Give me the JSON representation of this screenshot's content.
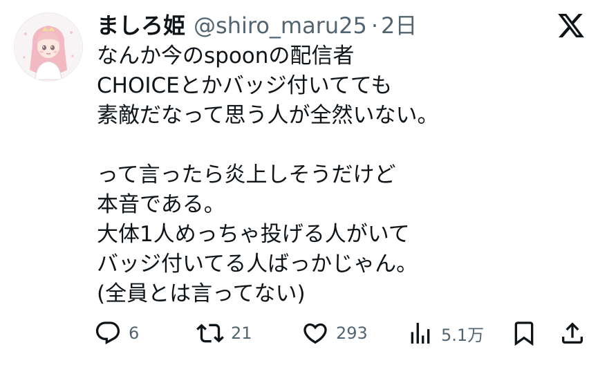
{
  "user": {
    "display_name": "ましろ姫",
    "handle": "@shiro_maru25",
    "separator": "·",
    "time": "2日"
  },
  "tweet": {
    "text": "なんか今のspoonの配信者\nCHOICEとかバッジ付いてても\n素敵だなって思う人が全然いない。\n\nって言ったら炎上しそうだけど\n本音である。\n大体1人めっちゃ投げる人がいて\nバッジ付いてる人ばっかじゃん。\n(全員とは言ってない)"
  },
  "actions": {
    "replies": "6",
    "retweets": "21",
    "likes": "293",
    "views": "5.1万"
  },
  "icons": {
    "logo": "x-logo-icon",
    "reply": "reply-icon",
    "retweet": "retweet-icon",
    "like": "heart-icon",
    "views": "views-icon",
    "bookmark": "bookmark-icon",
    "share": "share-icon"
  },
  "colors": {
    "text": "#0f1419",
    "secondary": "#536471",
    "background": "#ffffff"
  }
}
